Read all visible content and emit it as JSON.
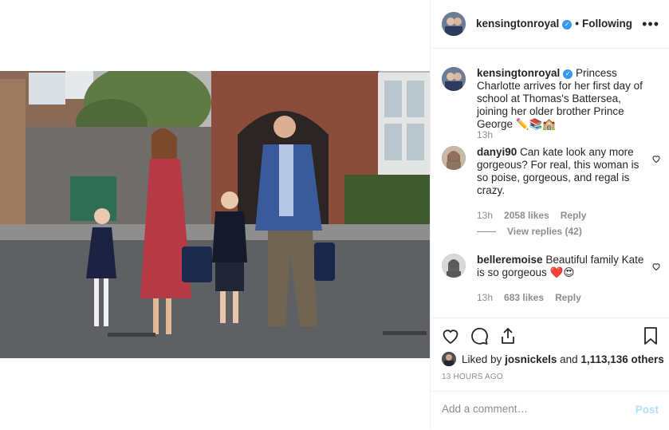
{
  "post": {
    "username": "kensingtonroyal",
    "follow_status": "Following",
    "photo_alt": "Family walking to school"
  },
  "caption": {
    "username": "kensingtonroyal",
    "text": "Princess Charlotte arrives for her first day of school at Thomas's Battersea, joining her older brother Prince George ✏️📚🏫",
    "time": "13h"
  },
  "comments": [
    {
      "username": "danyi90",
      "text": "Can kate look any more gorgeous? For real, this woman is so poise, gorgeous, and regal is crazy.",
      "time": "13h",
      "likes": "2058 likes",
      "reply": "Reply",
      "view_replies": "View replies (42)"
    },
    {
      "username": "belleremoise",
      "text": "Beautiful family Kate is so gorgeous ❤️😍",
      "time": "13h",
      "likes": "683 likes",
      "reply": "Reply"
    }
  ],
  "likes": {
    "prefix": "Liked by",
    "user": "josnickels",
    "joiner": "and",
    "others": "1,113,136 others"
  },
  "time_ago": "13 HOURS AGO",
  "add_comment": {
    "placeholder": "Add a comment…",
    "post_label": "Post"
  },
  "colors": {
    "verified": "#3897f0",
    "post_disabled": "#b2dffc",
    "muted": "#8e8e8e"
  }
}
